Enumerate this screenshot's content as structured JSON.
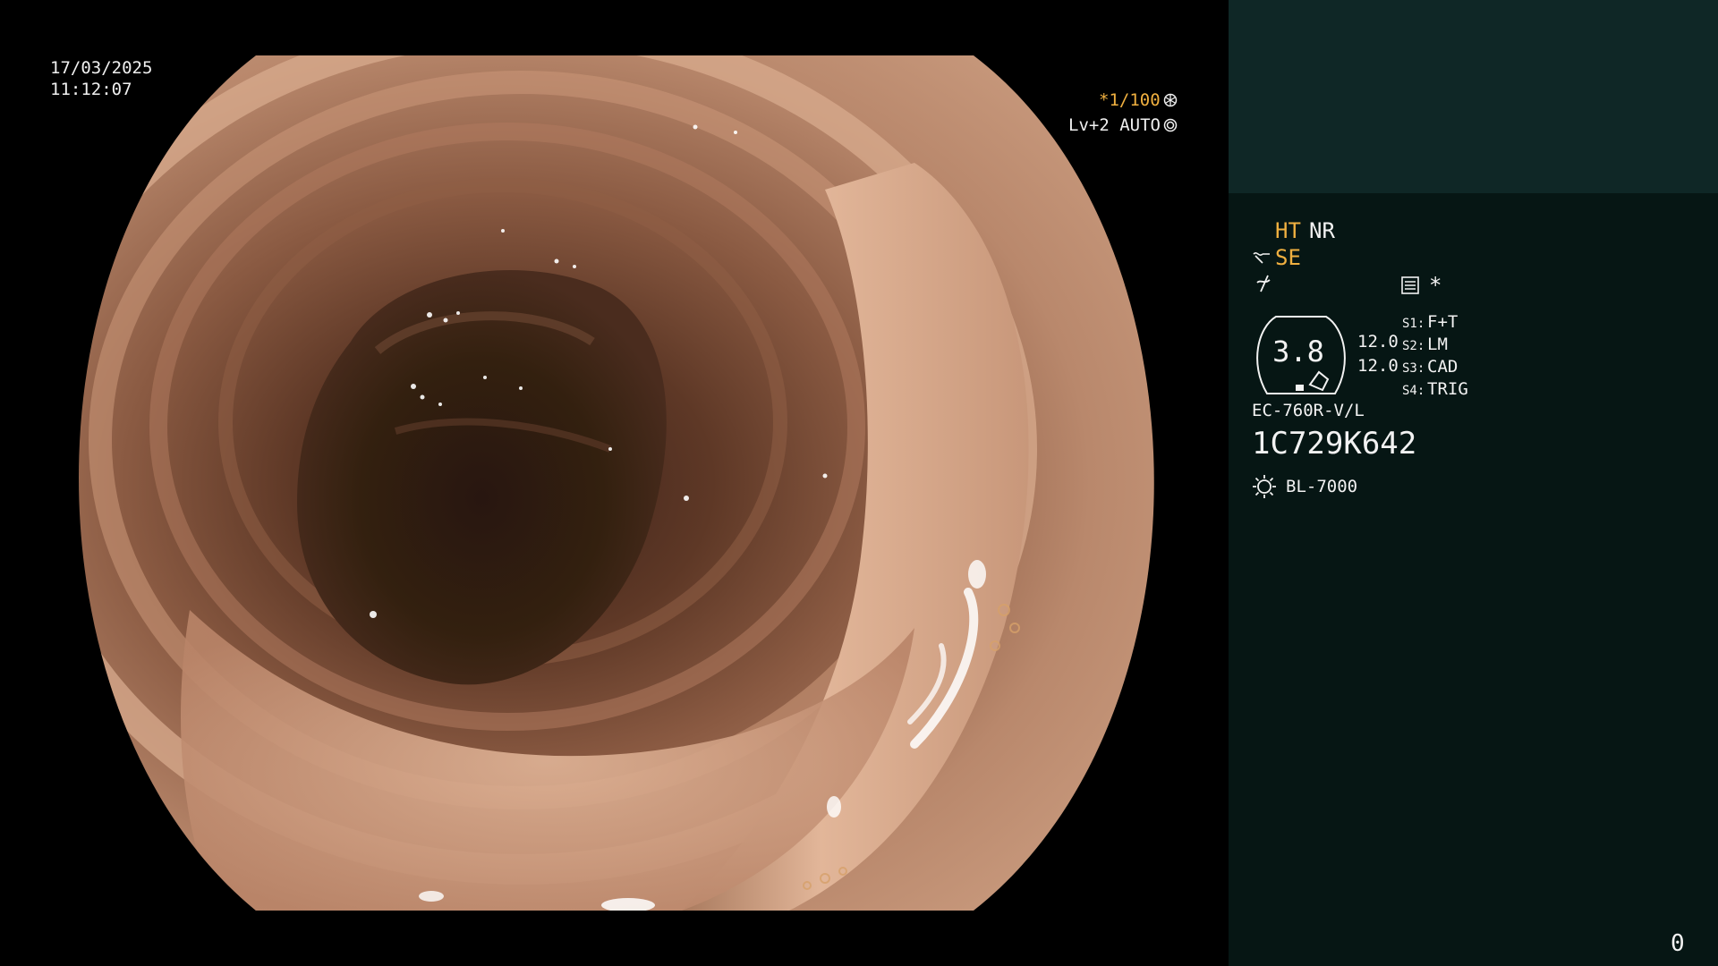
{
  "overlay": {
    "date": "17/03/2025",
    "time": "11:12:07",
    "shutter": "*1/100",
    "iris": "Lv+2 AUTO",
    "shutter_icon": "aperture-icon",
    "iris_icon": "iris-ring-icon"
  },
  "panel": {
    "mode_ht": "HT",
    "mode_nr": "NR",
    "mode_se": "SE",
    "star": "*",
    "zoom_value": "3.8",
    "value_1": "12.0",
    "value_2": "12.0",
    "switches": [
      {
        "key": "S1:",
        "value": "F+T"
      },
      {
        "key": "S2:",
        "value": "LM"
      },
      {
        "key": "S3:",
        "value": "CAD"
      },
      {
        "key": "S4:",
        "value": "TRIG"
      }
    ],
    "scope_model": "EC-760R-V/L",
    "serial": "1C729K642",
    "lamp": "BL-7000",
    "counter": "0"
  },
  "colors": {
    "panel_bg": "#061614",
    "thumb_bg": "#0f2726",
    "amber": "#f0b040",
    "text": "#f2f2f2"
  }
}
